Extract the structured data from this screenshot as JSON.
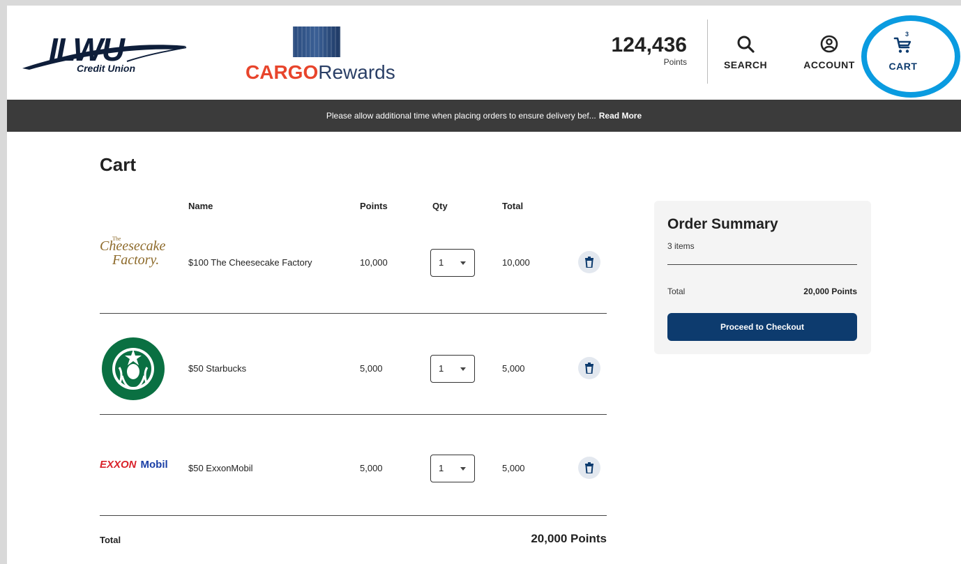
{
  "header": {
    "bank_logo": {
      "name": "ILWU",
      "sub": "Credit Union"
    },
    "program_logo": {
      "bold": "CARGO",
      "light": "Rewards"
    },
    "points_value": "124,436",
    "points_label": "Points",
    "nav": {
      "search": "SEARCH",
      "account": "ACCOUNT",
      "cart": "CART",
      "cart_count": "3"
    },
    "highlight_color": "#0a9be0"
  },
  "banner": {
    "message": "Please allow additional time when placing orders to ensure delivery bef...",
    "link": "Read More"
  },
  "cart": {
    "title": "Cart",
    "columns": {
      "name": "Name",
      "points": "Points",
      "qty": "Qty",
      "total": "Total"
    },
    "items": [
      {
        "logo": "cheesecake-factory-logo",
        "name": "$100 The Cheesecake Factory",
        "points": "10,000",
        "qty": "1",
        "total": "10,000"
      },
      {
        "logo": "starbucks-logo",
        "name": "$50 Starbucks",
        "points": "5,000",
        "qty": "1",
        "total": "5,000"
      },
      {
        "logo": "exxonmobil-logo",
        "name": "$50 ExxonMobil",
        "points": "5,000",
        "qty": "1",
        "total": "5,000"
      }
    ],
    "logo_text": {
      "cheesecake": {
        "the": "The",
        "line1": "Cheesecake",
        "line2": "Factory."
      },
      "exxon": {
        "ex": "EXXON",
        "mobil": "Mobil"
      }
    },
    "total_label": "Total",
    "total_value": "20,000 Points"
  },
  "summary": {
    "title": "Order Summary",
    "count": "3 items",
    "total_label": "Total",
    "total_value": "20,000 Points",
    "checkout": "Proceed to Checkout"
  },
  "colors": {
    "primary": "#0d3b6e",
    "banner_bg": "#3b3b3b",
    "summary_bg": "#f4f4f4"
  }
}
